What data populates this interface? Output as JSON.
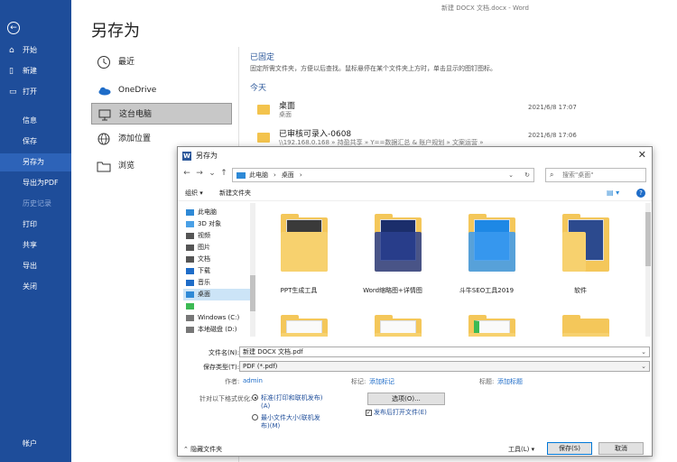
{
  "window": {
    "doc_title": "新建 DOCX 文档.docx - Word"
  },
  "backstage": {
    "back_icon": "←",
    "items": [
      {
        "label": "开始",
        "icon": "⌂"
      },
      {
        "label": "新建",
        "icon": "▯"
      },
      {
        "label": "打开",
        "icon": "▭"
      },
      {
        "label": "信息"
      },
      {
        "label": "保存"
      },
      {
        "label": "另存为"
      },
      {
        "label": "导出为PDF"
      },
      {
        "label": "历史记录"
      },
      {
        "label": "打印"
      },
      {
        "label": "共享"
      },
      {
        "label": "导出"
      },
      {
        "label": "关闭"
      },
      {
        "label": "帐户"
      }
    ]
  },
  "main": {
    "title": "另存为",
    "locations": [
      {
        "label": "最近"
      },
      {
        "label": "OneDrive"
      },
      {
        "label": "这台电脑"
      },
      {
        "label": "添加位置"
      },
      {
        "label": "浏览"
      }
    ],
    "pinned": {
      "title": "已固定",
      "desc": "固定所需文件夹，方便以后查找。鼠标悬停在某个文件夹上方时，单击显示的图钉图标。"
    },
    "today": {
      "title": "今天",
      "rows": [
        {
          "name": "桌面",
          "sub": "桌面",
          "date": "2021/6/8 17:07"
        },
        {
          "name": "已审核可录入-0608",
          "sub": "\\\\192.168.0.168 » 持盈共享 » Y==数据汇总 & 账户规划 » 文案运营 »",
          "date": "2021/6/8 17:06"
        }
      ]
    }
  },
  "dialog": {
    "title": "另存为",
    "title_icon": "W",
    "close": "✕",
    "nav": {
      "back": "←",
      "forward": "→",
      "up_list": "⌄",
      "up": "↑"
    },
    "address": {
      "segments": [
        "此电脑",
        "›",
        "桌面",
        "›"
      ],
      "dropdown": "⌄",
      "refresh": "↻"
    },
    "search_placeholder": "搜索\"桌面\"",
    "toolbar": {
      "organize": "组织 ▾",
      "new_folder": "新建文件夹",
      "view": "▤ ▾",
      "help": "?"
    },
    "tree": [
      {
        "label": "此电脑",
        "color": "#2e89d6"
      },
      {
        "label": "3D 对象",
        "color": "#4aa0e6"
      },
      {
        "label": "视频",
        "color": "#555555"
      },
      {
        "label": "图片",
        "color": "#555555"
      },
      {
        "label": "文档",
        "color": "#555555"
      },
      {
        "label": "下载",
        "color": "#1e6cc8"
      },
      {
        "label": "音乐",
        "color": "#1e6cc8"
      },
      {
        "label": "桌面",
        "color": "#2e89d6"
      },
      {
        "label": "",
        "color": "#3cba54"
      },
      {
        "label": "Windows (C:)",
        "color": "#777777"
      },
      {
        "label": "本地磁盘 (D:)",
        "color": "#777777"
      }
    ],
    "files": [
      {
        "name": "PPT生成工具"
      },
      {
        "name": "Word缩略图+详情图"
      },
      {
        "name": "斗牛SEO工具2019"
      },
      {
        "name": "软件"
      },
      {
        "name": ""
      },
      {
        "name": ""
      },
      {
        "name": ""
      },
      {
        "name": ""
      }
    ],
    "form": {
      "filename_label": "文件名(N):",
      "filename_value": "新建 DOCX 文档.pdf",
      "filetype_label": "保存类型(T):",
      "filetype_value": "PDF (*.pdf)",
      "author_label": "作者:",
      "author_value": "admin",
      "tags_label": "标记:",
      "tags_value": "添加标记",
      "title_label": "标题:",
      "title_value": "添加标题",
      "optimize_label": "针对以下格式优化:",
      "opt_standard": "标准(打印和联机发布)",
      "opt_standard_key": "(A)",
      "opt_min": "最小文件大小(联机发",
      "opt_min_2": "布)(M)",
      "options_btn": "选项(O)...",
      "open_after": "发布后打开文件(E)",
      "hide_folders": "隐藏文件夹",
      "tools": "工具(L)",
      "save": "保存(S)",
      "cancel": "取消"
    }
  }
}
